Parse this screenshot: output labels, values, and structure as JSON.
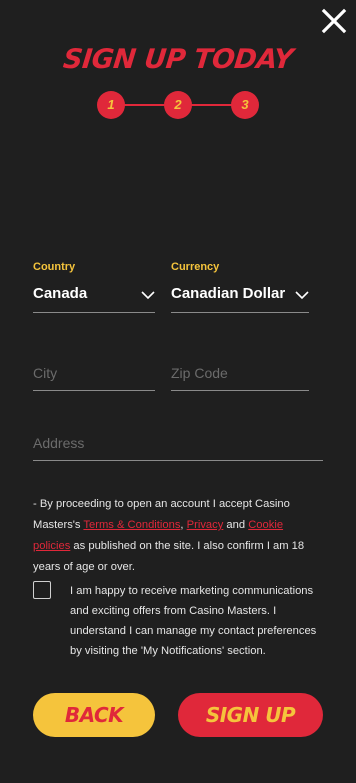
{
  "header": {
    "title": "SIGN UP TODAY",
    "close_icon": "close-icon"
  },
  "steps": [
    "1",
    "2",
    "3"
  ],
  "form": {
    "country": {
      "label": "Country",
      "value": "Canada"
    },
    "currency": {
      "label": "Currency",
      "value": "Canadian Dollar"
    },
    "city": {
      "placeholder": "City"
    },
    "zip": {
      "placeholder": "Zip Code"
    },
    "address": {
      "placeholder": "Address"
    }
  },
  "terms": {
    "prefix": "- By proceeding to open an account I accept Casino Masters's ",
    "link_terms": "Terms & Conditions",
    "comma": ", ",
    "link_privacy": "Privacy",
    "and": " and ",
    "link_cookies": "Cookie policies",
    "suffix": " as published on the site. I also confirm I am 18 years of age or over."
  },
  "marketing": {
    "checked": false,
    "text": "I am happy to receive marketing communications and exciting offers from Casino Masters. I understand I can manage my contact preferences by visiting the 'My Notifications' section."
  },
  "buttons": {
    "back": "BACK",
    "signup": "SIGN UP"
  },
  "colors": {
    "background": "#1f1f1f",
    "accent_red": "#e0283a",
    "accent_yellow": "#f5c43c"
  }
}
